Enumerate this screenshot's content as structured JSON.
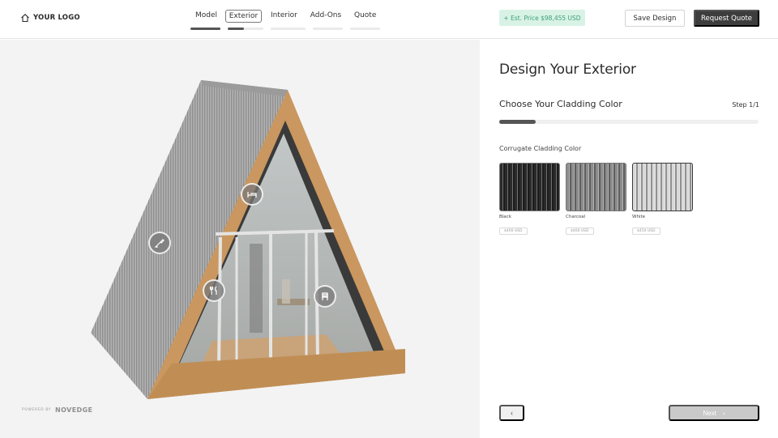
{
  "header": {
    "logo_text": "YOUR LOGO",
    "logo_icon": "home-icon",
    "tabs": [
      {
        "label": "Model",
        "progress": 1.0
      },
      {
        "label": "Exterior",
        "progress": 0.45,
        "active": true
      },
      {
        "label": "Interior",
        "progress": 0
      },
      {
        "label": "Add-Ons",
        "progress": 0
      },
      {
        "label": "Quote",
        "progress": 0
      }
    ],
    "price_badge": "+  Est. Price $98,455 USD",
    "save_label": "Save Design",
    "request_label": "Request Quote"
  },
  "viewer": {
    "hotspots": [
      {
        "name": "hotspot-roof",
        "icon": "paint-brush-icon"
      },
      {
        "name": "hotspot-bedroom",
        "icon": "bed-icon"
      },
      {
        "name": "hotspot-kitchen",
        "icon": "utensils-icon"
      },
      {
        "name": "hotspot-dining",
        "icon": "chair-icon"
      }
    ],
    "powered_by": "POWERED BY",
    "powered_brand": "NOVEDGE"
  },
  "panel": {
    "title": "Design Your Exterior",
    "subtitle": "Choose Your Cladding Color",
    "step": "Step 1/1",
    "progress": 0.14,
    "section_label": "Corrugate Cladding Color",
    "swatches": [
      {
        "name": "Black",
        "price": "$400 USD",
        "color": "#2a2a2a"
      },
      {
        "name": "Charcoal",
        "price": "$400 USD",
        "color": "#8d8d8d"
      },
      {
        "name": "White",
        "price": "$450 USD",
        "color": "#d9d9d9",
        "selected": true
      }
    ],
    "back_label": "‹",
    "next_label": "Next",
    "next_icon": "›"
  },
  "colors": {
    "primary_dark": "#3d3d3d",
    "price_bg": "#d9f2e6",
    "price_text": "#3aa17a",
    "wood": "#c9975f",
    "metal_roof": "#a8a8a8"
  }
}
